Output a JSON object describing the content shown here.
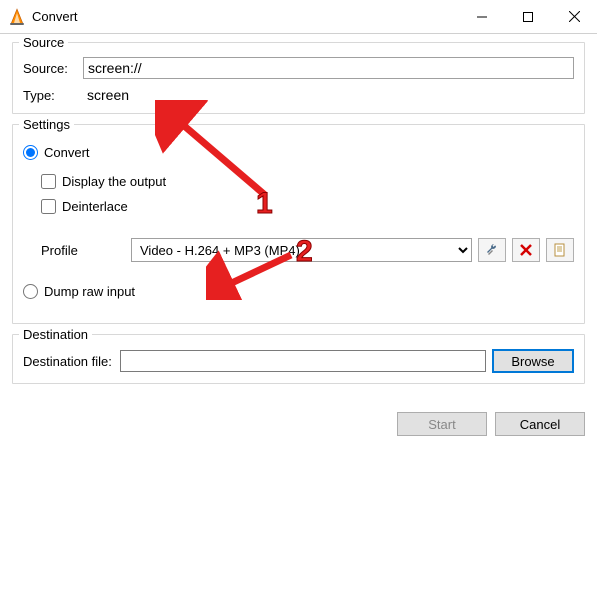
{
  "window": {
    "title": "Convert"
  },
  "titlebar_icons": {
    "min": "minimize",
    "max": "maximize",
    "close": "close"
  },
  "source": {
    "group_label": "Source",
    "source_label": "Source:",
    "source_value": "screen://",
    "type_label": "Type:",
    "type_value": "screen"
  },
  "settings": {
    "group_label": "Settings",
    "convert_label": "Convert",
    "display_output_label": "Display the output",
    "deinterlace_label": "Deinterlace",
    "profile_label": "Profile",
    "profile_value": "Video - H.264 + MP3 (MP4)",
    "dump_raw_label": "Dump raw input"
  },
  "destination": {
    "group_label": "Destination",
    "file_label": "Destination file:",
    "file_value": "",
    "browse_label": "Browse"
  },
  "buttons": {
    "start": "Start",
    "cancel": "Cancel"
  },
  "annotations": {
    "n1": "1",
    "n2": "2"
  }
}
